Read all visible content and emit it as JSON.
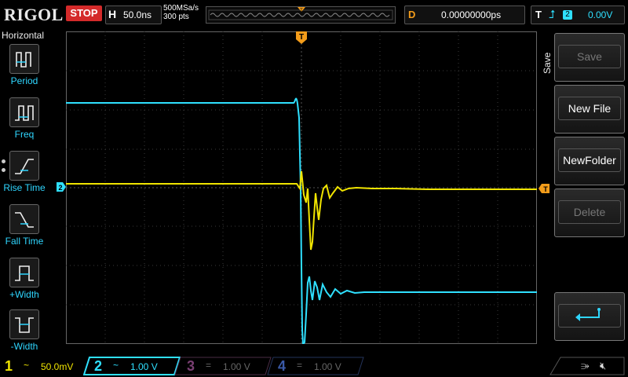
{
  "header": {
    "brand": "RIGOL",
    "run_status": "STOP",
    "horizontal_label": "H",
    "timebase": "50.0ns",
    "sample_rate": "500MSa/s",
    "memory_depth": "300  pts",
    "delay_label": "D",
    "delay_value": "0.00000000ps",
    "trigger_label": "T",
    "trigger_slope_icon": "rising-edge",
    "trigger_source": "2",
    "trigger_level": "0.00V"
  },
  "left_menu": {
    "title": "Horizontal",
    "items": [
      {
        "label": "Period",
        "icon": "period-icon"
      },
      {
        "label": "Freq",
        "icon": "freq-icon"
      },
      {
        "label": "Rise Time",
        "icon": "rise-time-icon"
      },
      {
        "label": "Fall Time",
        "icon": "fall-time-icon"
      },
      {
        "label": "+Width",
        "icon": "pos-width-icon"
      },
      {
        "label": "-Width",
        "icon": "neg-width-icon"
      }
    ]
  },
  "right_menu": {
    "title": "Save",
    "buttons": [
      {
        "label": "Save",
        "enabled": false
      },
      {
        "label": "New File",
        "enabled": true
      },
      {
        "label": "NewFolder",
        "enabled": true
      },
      {
        "label": "Delete",
        "enabled": false
      },
      {
        "label": "",
        "icon": "return-icon",
        "enabled": true
      }
    ]
  },
  "markers": {
    "trigger_top": "T",
    "ch2_marker": "2",
    "trigger_level_marker": "T"
  },
  "channels": [
    {
      "number": "1",
      "coupling": "~",
      "scale": "50.0mV",
      "color": "#f0e400",
      "active": true
    },
    {
      "number": "2",
      "coupling": "~",
      "scale": "1.00 V",
      "color": "#2fe0ff",
      "active": true
    },
    {
      "number": "3",
      "coupling": "=",
      "scale": "1.00 V",
      "color": "#b0489c",
      "active": false
    },
    {
      "number": "4",
      "coupling": "=",
      "scale": "1.00 V",
      "color": "#2f5fd6",
      "active": false
    }
  ],
  "colors": {
    "ch1": "#f0e400",
    "ch2": "#2fe0ff",
    "trigger": "#f39c1a",
    "stop": "#d42a2a"
  }
}
